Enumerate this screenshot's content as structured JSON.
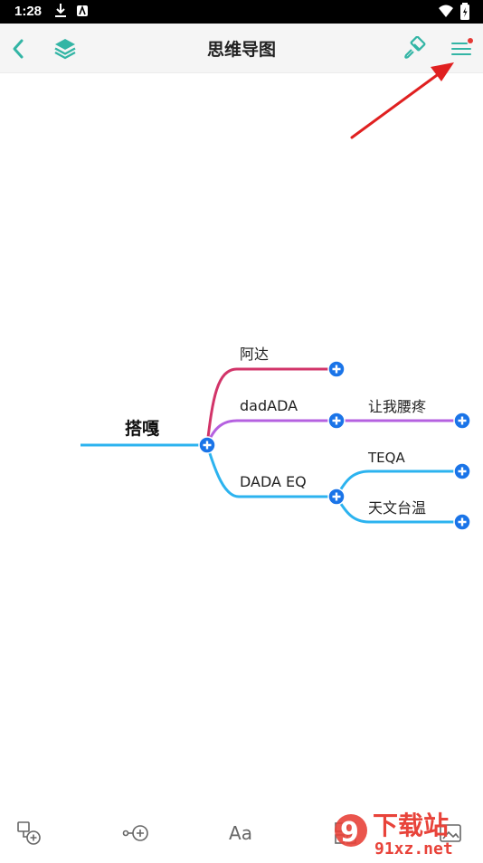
{
  "status_bar": {
    "time": "1:28"
  },
  "app_bar": {
    "title": "思维导图"
  },
  "mindmap": {
    "root": "搭嘎",
    "branch_1": "阿达",
    "branch_2": "dadADA",
    "branch_2_child": "让我腰疼",
    "branch_3": "DADA EQ",
    "branch_3_child_1": "TEQA",
    "branch_3_child_2": "天文台温"
  },
  "toolbar": {
    "font_label": "Aa"
  },
  "watermark": {
    "brand_cn": "下载站",
    "brand_url": "91xz.net"
  },
  "colors": {
    "accent": "#33b5a5",
    "branch_red": "#d23469",
    "branch_purple": "#b561e0",
    "branch_blue": "#2cb3ef",
    "root_line": "#2cb3ef",
    "add_button": "#1a74e8",
    "annotation_arrow": "#e02020"
  }
}
